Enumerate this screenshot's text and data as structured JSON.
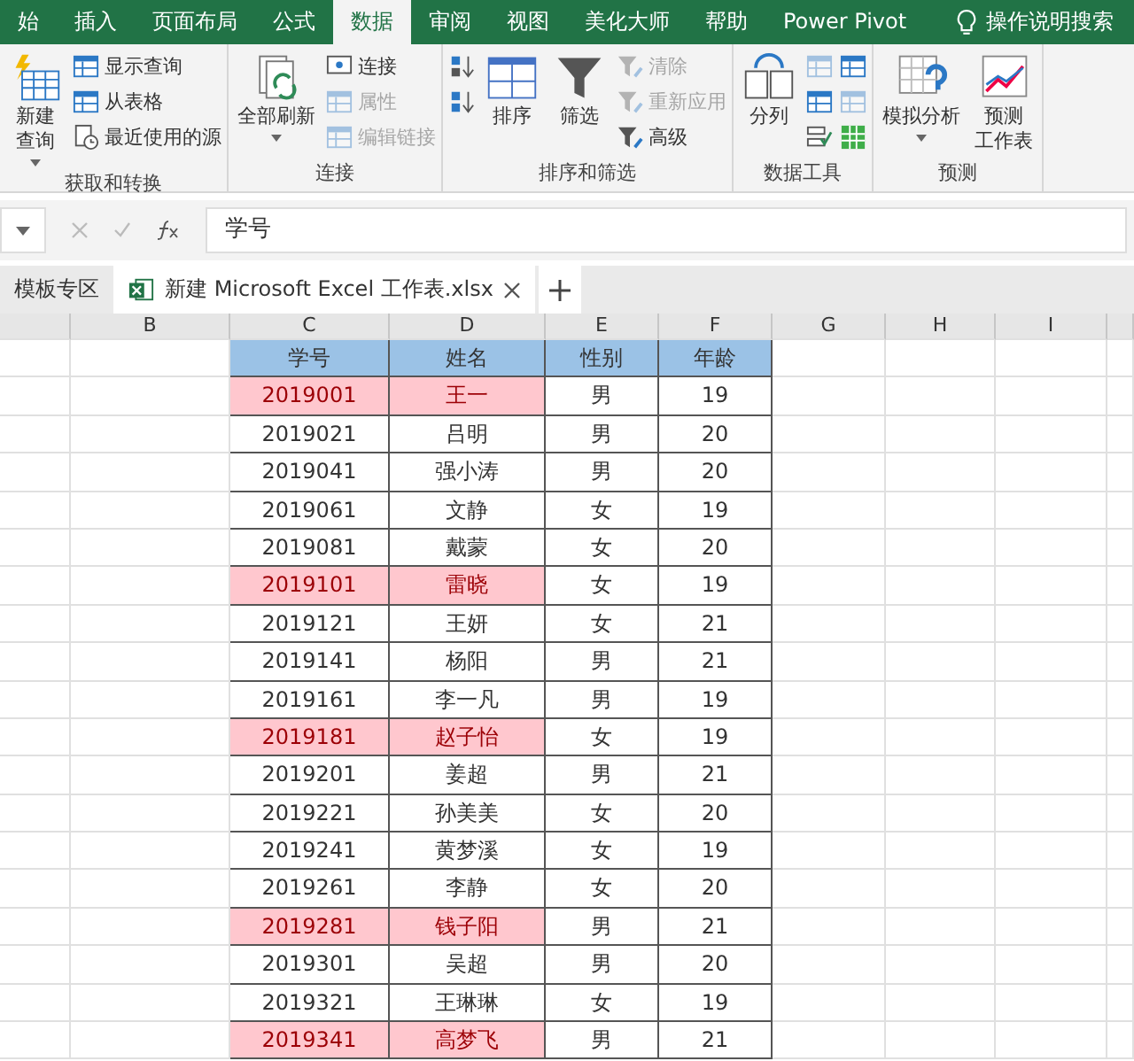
{
  "ribbon_tabs": [
    {
      "label": "始",
      "selected": false
    },
    {
      "label": "插入",
      "selected": false
    },
    {
      "label": "页面布局",
      "selected": false
    },
    {
      "label": "公式",
      "selected": false
    },
    {
      "label": "数据",
      "selected": true
    },
    {
      "label": "审阅",
      "selected": false
    },
    {
      "label": "视图",
      "selected": false
    },
    {
      "label": "美化大师",
      "selected": false
    },
    {
      "label": "帮助",
      "selected": false
    },
    {
      "label": "Power Pivot",
      "selected": false
    }
  ],
  "tell_me": "操作说明搜索",
  "groups": [
    {
      "label": "获取和转换",
      "items": [
        {
          "kind": "large",
          "lines": [
            "新建",
            "查询"
          ],
          "dropdown": true
        },
        {
          "kind": "stack",
          "entries": [
            {
              "label": "显示查询",
              "disabled": false
            },
            {
              "label": "从表格",
              "disabled": false
            },
            {
              "label": "最近使用的源",
              "disabled": false
            }
          ]
        }
      ]
    },
    {
      "label": "连接",
      "items": [
        {
          "kind": "large",
          "lines": [
            "全部刷新"
          ],
          "dropdown": true
        },
        {
          "kind": "stack",
          "entries": [
            {
              "label": "连接",
              "disabled": false
            },
            {
              "label": "属性",
              "disabled": true
            },
            {
              "label": "编辑链接",
              "disabled": true
            }
          ]
        }
      ]
    },
    {
      "label": "排序和筛选",
      "items": [
        {
          "kind": "stack",
          "entries": [
            {
              "disabled": false
            },
            {
              "disabled": false
            }
          ]
        },
        {
          "kind": "large",
          "lines": [
            "排序"
          ],
          "dropdown": false
        },
        {
          "kind": "large",
          "lines": [
            "筛选"
          ],
          "dropdown": false
        },
        {
          "kind": "stack",
          "entries": [
            {
              "label": "清除",
              "disabled": true
            },
            {
              "label": "重新应用",
              "disabled": true
            },
            {
              "label": "高级",
              "disabled": false
            }
          ]
        }
      ]
    },
    {
      "label": "数据工具",
      "items": [
        {
          "kind": "large",
          "lines": [
            "分列"
          ],
          "dropdown": false
        },
        {
          "kind": "stack",
          "entries": [
            {
              "disabled": true
            },
            {
              "disabled": false
            },
            {
              "disabled": false
            }
          ]
        },
        {
          "kind": "stack",
          "entries": [
            {
              "disabled": false
            },
            {
              "disabled": true
            },
            {
              "disabled": false
            }
          ]
        }
      ]
    },
    {
      "label": "预测",
      "items": [
        {
          "kind": "large",
          "lines": [
            "模拟分析"
          ],
          "dropdown": true
        },
        {
          "kind": "large",
          "lines": [
            "预测",
            "工作表"
          ],
          "dropdown": false
        }
      ]
    }
  ],
  "formula_bar": {
    "value": "学号"
  },
  "workbook_tabs": [
    {
      "label": "模板专区",
      "selected": false
    },
    {
      "label": "新建 Microsoft Excel 工作表.xlsx",
      "selected": true
    }
  ],
  "column_headers": [
    "B",
    "C",
    "D",
    "E",
    "F",
    "G",
    "H",
    "I"
  ],
  "table": {
    "columns": [
      "学号",
      "姓名",
      "性别",
      "年龄"
    ],
    "rows": [
      {
        "id": "2019001",
        "name": "王一",
        "gender": "男",
        "age": "19",
        "highlighted": true
      },
      {
        "id": "2019021",
        "name": "吕明",
        "gender": "男",
        "age": "20",
        "highlighted": false
      },
      {
        "id": "2019041",
        "name": "强小涛",
        "gender": "男",
        "age": "20",
        "highlighted": false
      },
      {
        "id": "2019061",
        "name": "文静",
        "gender": "女",
        "age": "19",
        "highlighted": false
      },
      {
        "id": "2019081",
        "name": "戴蒙",
        "gender": "女",
        "age": "20",
        "highlighted": false
      },
      {
        "id": "2019101",
        "name": "雷晓",
        "gender": "女",
        "age": "19",
        "highlighted": true
      },
      {
        "id": "2019121",
        "name": "王妍",
        "gender": "女",
        "age": "21",
        "highlighted": false
      },
      {
        "id": "2019141",
        "name": "杨阳",
        "gender": "男",
        "age": "21",
        "highlighted": false
      },
      {
        "id": "2019161",
        "name": "李一凡",
        "gender": "男",
        "age": "19",
        "highlighted": false
      },
      {
        "id": "2019181",
        "name": "赵子怡",
        "gender": "女",
        "age": "19",
        "highlighted": true
      },
      {
        "id": "2019201",
        "name": "姜超",
        "gender": "男",
        "age": "21",
        "highlighted": false
      },
      {
        "id": "2019221",
        "name": "孙美美",
        "gender": "女",
        "age": "20",
        "highlighted": false
      },
      {
        "id": "2019241",
        "name": "黄梦溪",
        "gender": "女",
        "age": "19",
        "highlighted": false
      },
      {
        "id": "2019261",
        "name": "李静",
        "gender": "女",
        "age": "20",
        "highlighted": false
      },
      {
        "id": "2019281",
        "name": "钱子阳",
        "gender": "男",
        "age": "21",
        "highlighted": true
      },
      {
        "id": "2019301",
        "name": "吴超",
        "gender": "男",
        "age": "20",
        "highlighted": false
      },
      {
        "id": "2019321",
        "name": "王琳琳",
        "gender": "女",
        "age": "19",
        "highlighted": false
      },
      {
        "id": "2019341",
        "name": "高梦飞",
        "gender": "男",
        "age": "21",
        "highlighted": true
      }
    ]
  }
}
